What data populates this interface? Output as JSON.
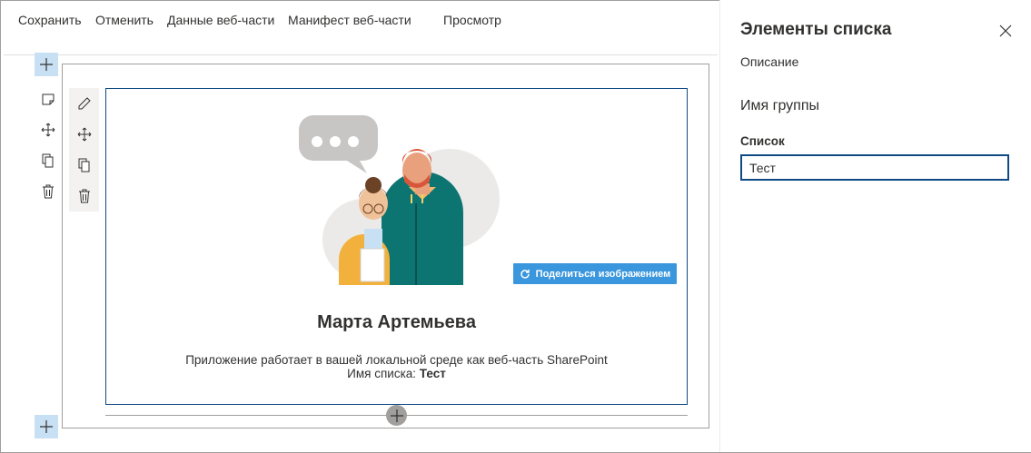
{
  "toolbar": {
    "save": "Сохранить",
    "cancel": "Отменить",
    "webpart_data": "Данные веб-части",
    "webpart_manifest": "Манифест веб-части",
    "preview": "Просмотр"
  },
  "webpart": {
    "share_button": "Поделиться изображением",
    "person_name": "Марта Артемьева",
    "description": "Приложение работает в вашей локальной среде как веб-часть SharePoint",
    "list_name_label": "Имя списка:",
    "list_name_value": "Тест"
  },
  "pane": {
    "title": "Элементы списка",
    "description": "Описание",
    "group_name": "Имя группы",
    "field_label": "Список",
    "field_value": "Тест"
  },
  "colors": {
    "accent": "#0f4a85",
    "add_button": "#c7e0f4",
    "share_button": "#3a96dd"
  }
}
